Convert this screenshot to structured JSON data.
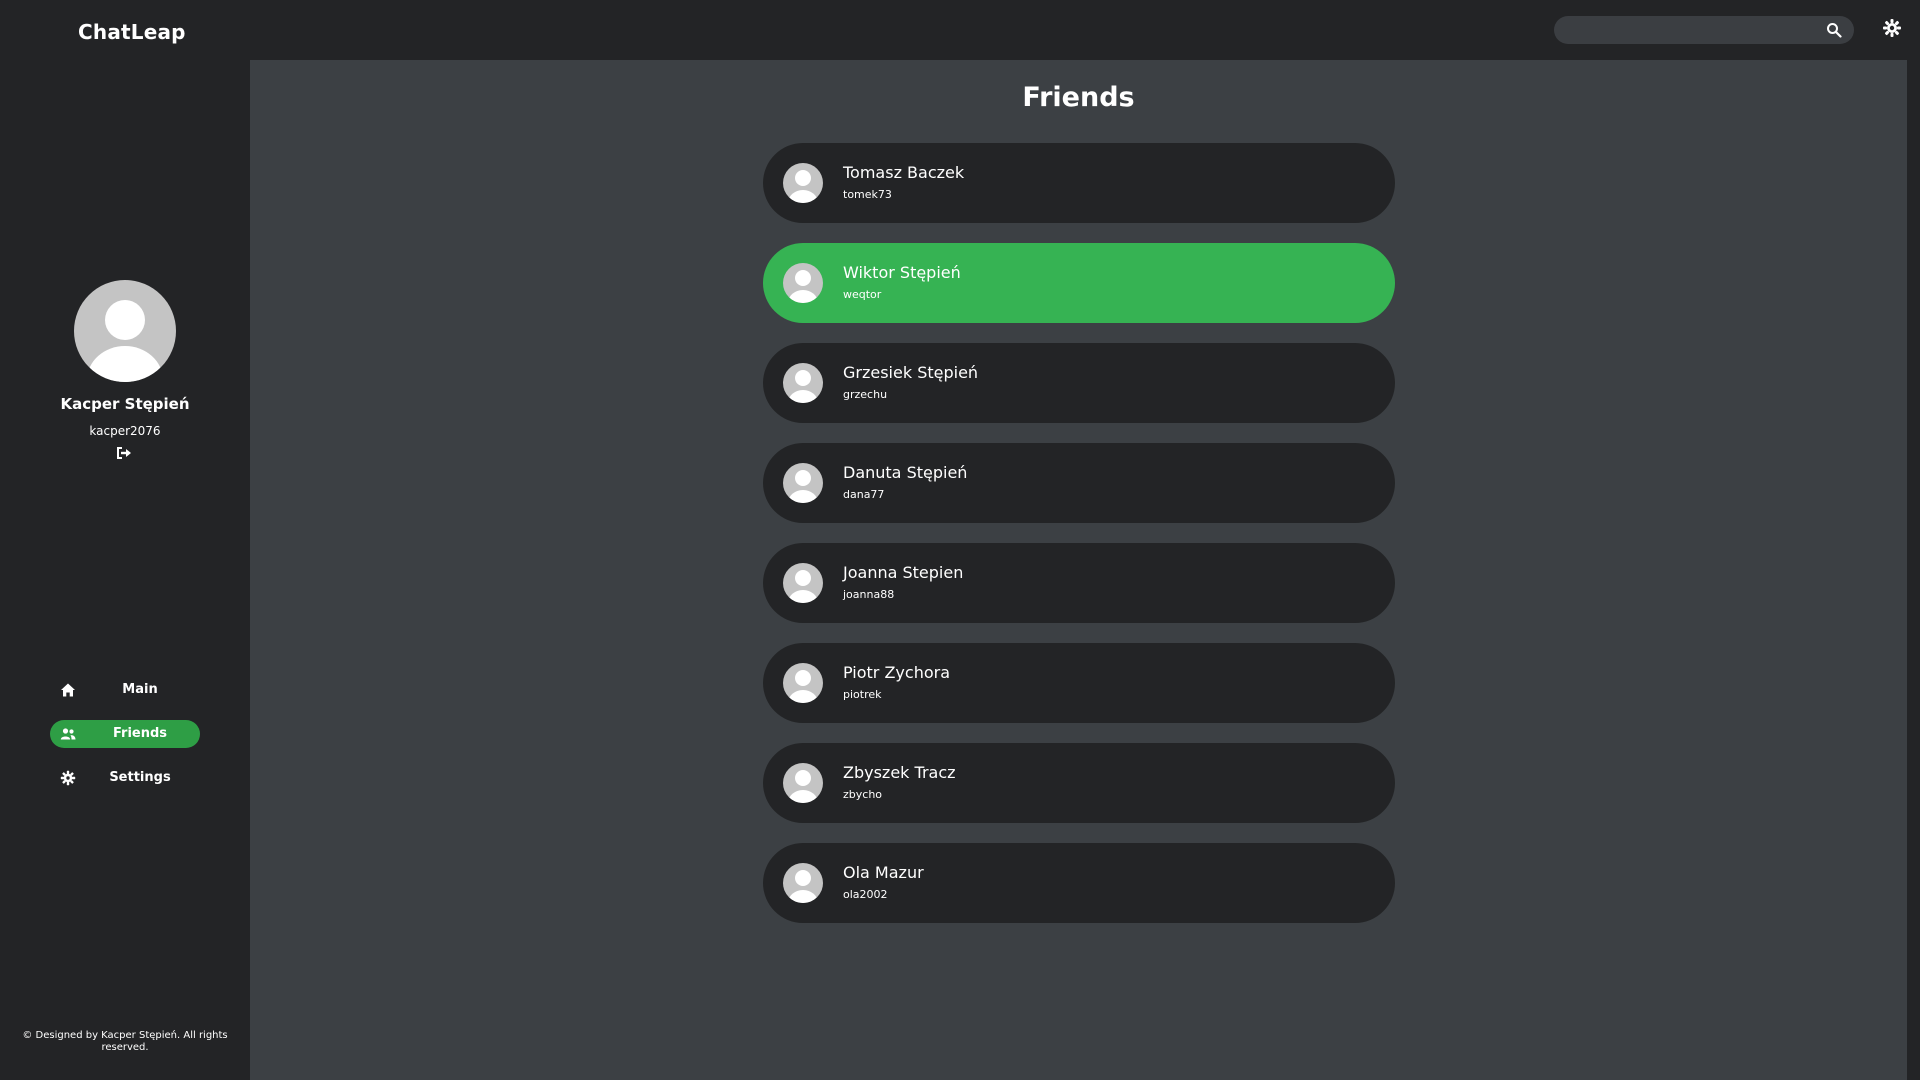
{
  "app": {
    "brand": "ChatLeap",
    "accent_color": "#36b353",
    "active_nav_color": "#2e9e45"
  },
  "header": {
    "search": {
      "value": "",
      "placeholder": "",
      "icon": "search-icon"
    },
    "theme_toggle_icon": "gear-icon"
  },
  "profile": {
    "name": "Kacper Stępień",
    "username": "kacper2076",
    "avatar_icon": "user-avatar-icon",
    "logout_icon": "logout-icon"
  },
  "nav": {
    "items": [
      {
        "label": "Main",
        "icon": "home-icon",
        "active": false
      },
      {
        "label": "Friends",
        "icon": "users-icon",
        "active": true
      },
      {
        "label": "Settings",
        "icon": "gear-icon",
        "active": false
      }
    ]
  },
  "footer": {
    "text": "© Designed by Kacper Stępień. All rights reserved."
  },
  "main": {
    "title": "Friends",
    "friends": [
      {
        "name": "Tomasz Baczek",
        "username": "tomek73",
        "selected": false
      },
      {
        "name": "Wiktor Stępień",
        "username": "weqtor",
        "selected": true
      },
      {
        "name": "Grzesiek Stępień",
        "username": "grzechu",
        "selected": false
      },
      {
        "name": "Danuta Stępień",
        "username": "dana77",
        "selected": false
      },
      {
        "name": "Joanna Stepien",
        "username": "joanna88",
        "selected": false
      },
      {
        "name": "Piotr Zychora",
        "username": "piotrek",
        "selected": false
      },
      {
        "name": "Zbyszek Tracz",
        "username": "zbycho",
        "selected": false
      },
      {
        "name": "Ola Mazur",
        "username": "ola2002",
        "selected": false
      }
    ]
  }
}
